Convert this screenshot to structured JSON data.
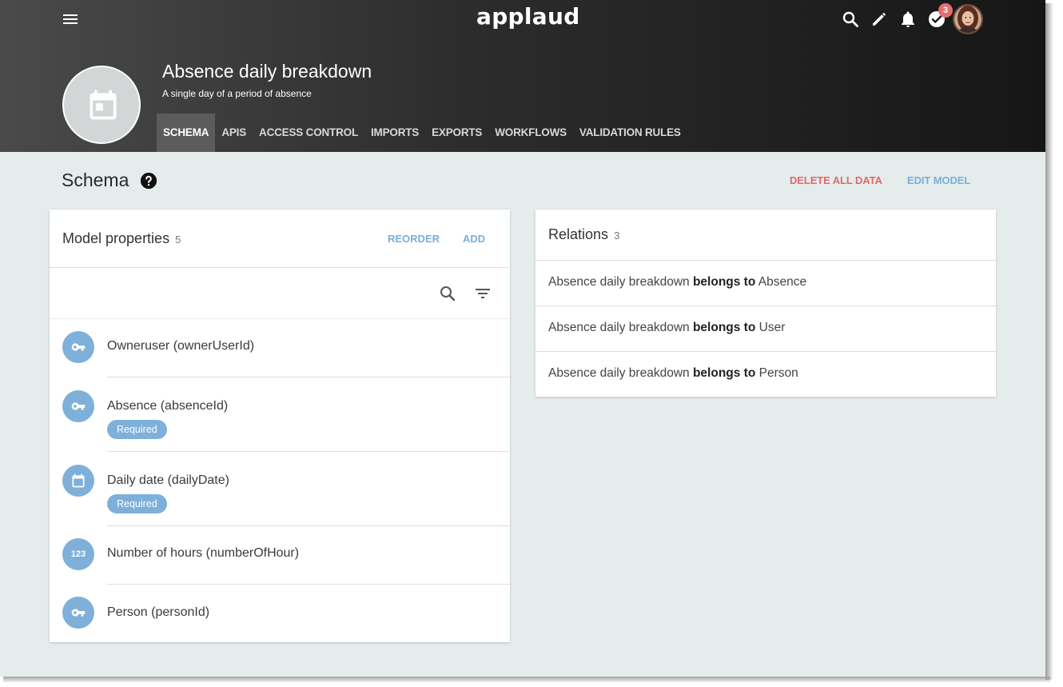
{
  "app": {
    "logo": "applaud",
    "notification_count": "3"
  },
  "model": {
    "title": "Absence daily breakdown",
    "subtitle": "A single day of a period of absence"
  },
  "tabs": [
    {
      "label": "SCHEMA",
      "active": true
    },
    {
      "label": "APIS"
    },
    {
      "label": "ACCESS CONTROL"
    },
    {
      "label": "IMPORTS"
    },
    {
      "label": "EXPORTS"
    },
    {
      "label": "WORKFLOWS"
    },
    {
      "label": "VALIDATION RULES"
    }
  ],
  "page": {
    "title": "Schema",
    "delete_all_label": "DELETE ALL DATA",
    "edit_model_label": "EDIT MODEL"
  },
  "properties_card": {
    "title": "Model properties",
    "count": "5",
    "reorder_label": "REORDER",
    "add_label": "ADD",
    "items": [
      {
        "label": "Owneruser (ownerUserId)",
        "icon": "key-icon",
        "badge": ""
      },
      {
        "label": "Absence (absenceId)",
        "icon": "key-icon",
        "badge": "Required"
      },
      {
        "label": "Daily date (dailyDate)",
        "icon": "calendar-icon",
        "badge": "Required"
      },
      {
        "label": "Number of hours (numberOfHour)",
        "icon": "number-icon",
        "icon_text": "123",
        "badge": ""
      },
      {
        "label": "Person (personId)",
        "icon": "key-icon",
        "badge": ""
      }
    ]
  },
  "relations_card": {
    "title": "Relations",
    "count": "3",
    "items": [
      {
        "subject": "Absence daily breakdown",
        "verb": "belongs to",
        "object": "Absence"
      },
      {
        "subject": "Absence daily breakdown",
        "verb": "belongs to",
        "object": "User"
      },
      {
        "subject": "Absence daily breakdown",
        "verb": "belongs to",
        "object": "Person"
      }
    ]
  },
  "colors": {
    "accent": "#7fb0d9",
    "danger": "#e06a6a",
    "badge": "#e06f6f",
    "page_background": "#e4ecec"
  }
}
